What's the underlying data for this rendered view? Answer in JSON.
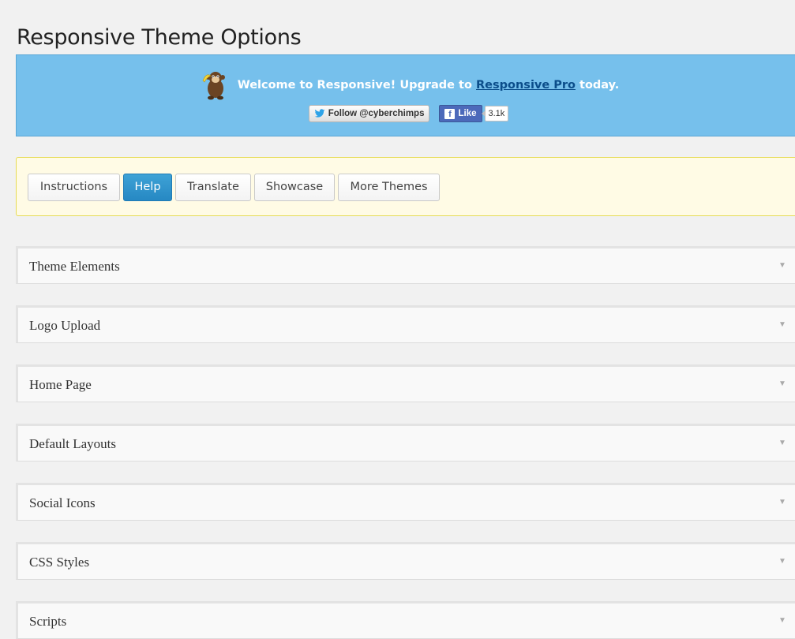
{
  "page": {
    "title": "Responsive Theme Options"
  },
  "banner": {
    "welcome_prefix": "Welcome to Responsive! Upgrade to ",
    "pro_link": "Responsive Pro",
    "welcome_suffix": " today.",
    "twitter_label": "Follow @cyberchimps",
    "fb_label": "Like",
    "fb_count": "3.1k",
    "background_color": "#76c0ec",
    "mascot_icon": "monkey-mascot-icon"
  },
  "toolbar": {
    "tabs": [
      {
        "label": "Instructions",
        "active": false
      },
      {
        "label": "Help",
        "active": true
      },
      {
        "label": "Translate",
        "active": false
      },
      {
        "label": "Showcase",
        "active": false
      },
      {
        "label": "More Themes",
        "active": false
      }
    ]
  },
  "sections": [
    {
      "label": "Theme Elements"
    },
    {
      "label": "Logo Upload"
    },
    {
      "label": "Home Page"
    },
    {
      "label": "Default Layouts"
    },
    {
      "label": "Social Icons"
    },
    {
      "label": "CSS Styles"
    },
    {
      "label": "Scripts"
    }
  ],
  "icons": {
    "section_toggle": "▼",
    "twitter": "twitter-bird-icon",
    "facebook": "facebook-f-icon"
  },
  "colors": {
    "active_tab": "#2a8fc9",
    "notice_bg": "#fffbe5",
    "banner_bg": "#76c0ec"
  }
}
